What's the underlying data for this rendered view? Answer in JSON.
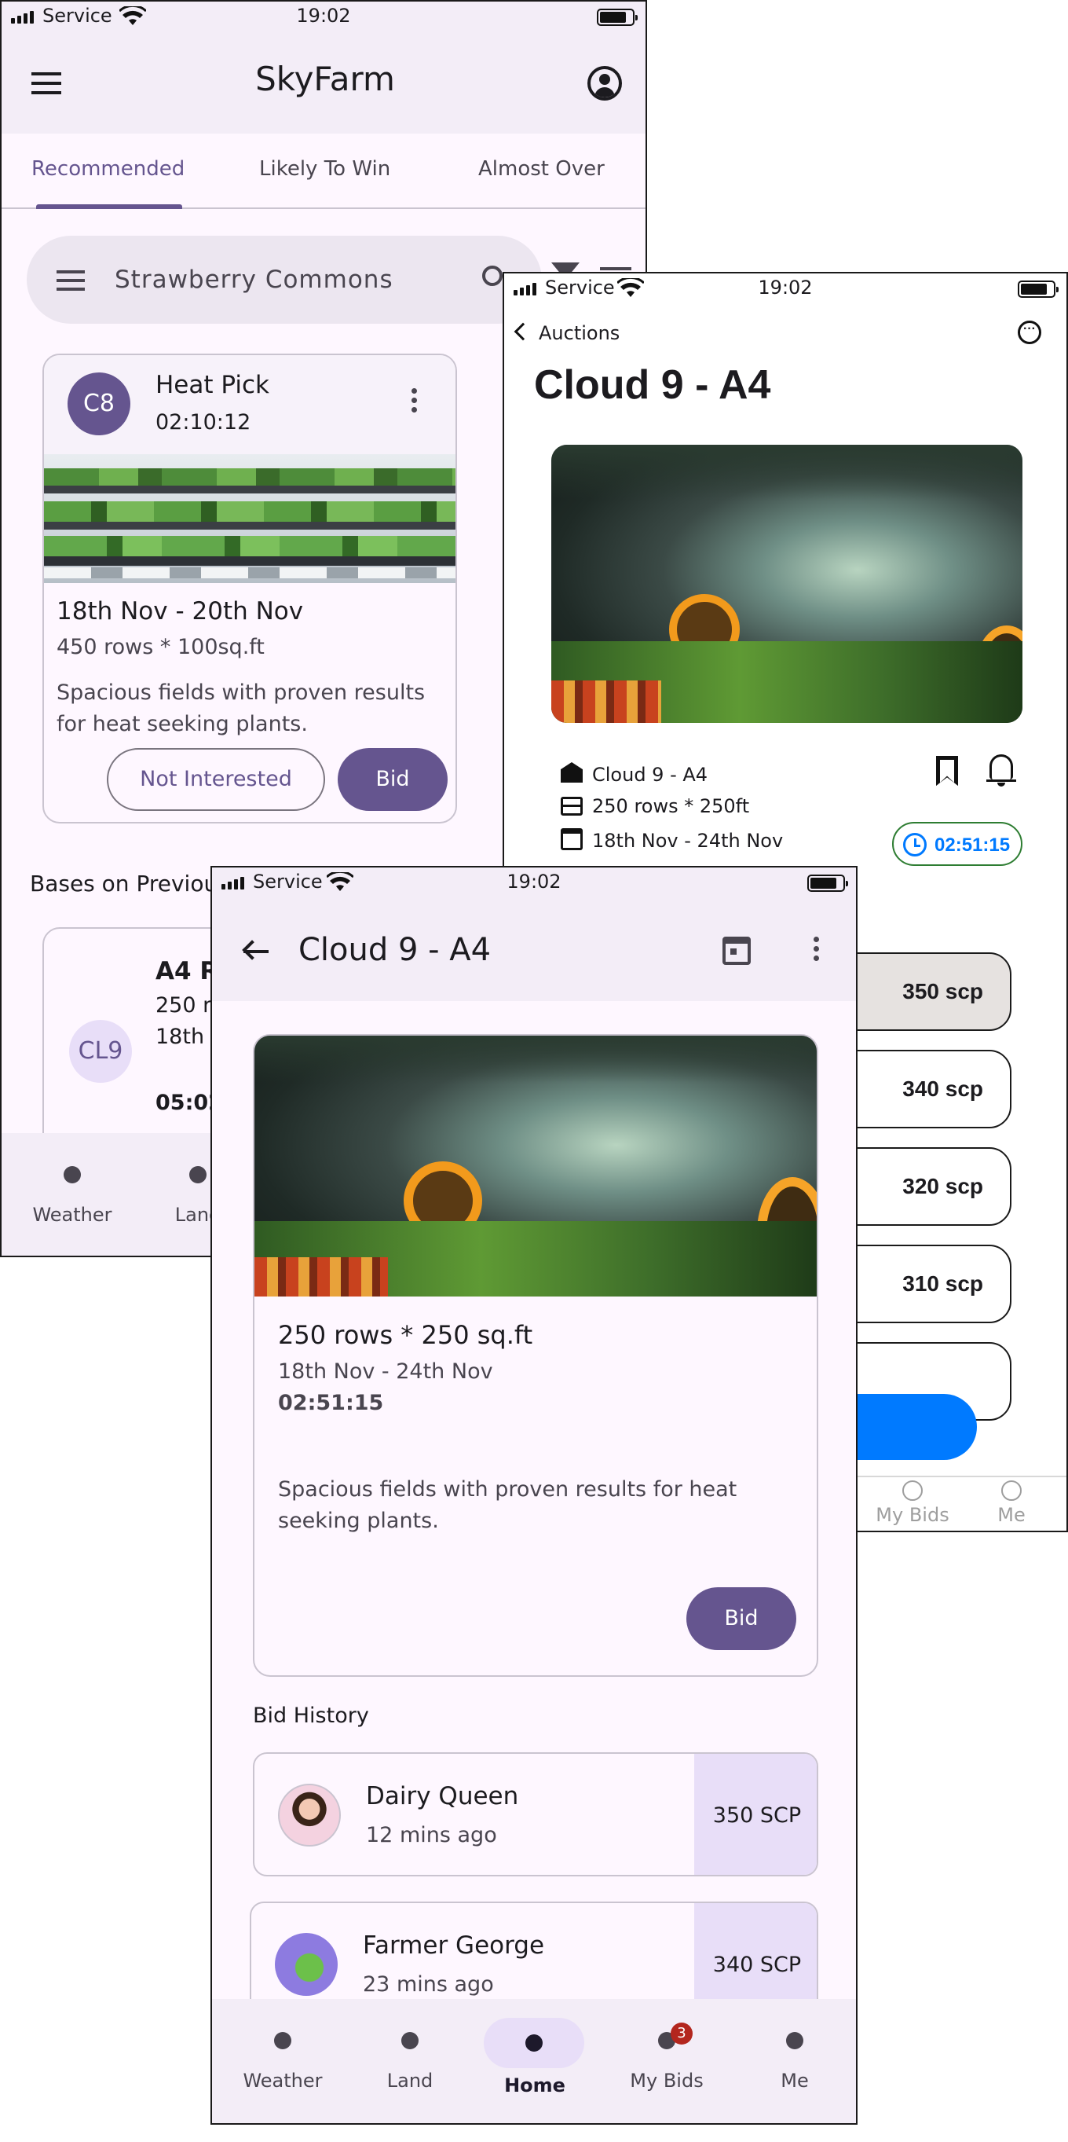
{
  "status": {
    "carrier": "Service",
    "time": "19:02"
  },
  "s1": {
    "app_title": "SkyFarm",
    "tabs": [
      "Recommended",
      "Likely To Win",
      "Almost Over"
    ],
    "search_placeholder": "Strawberry Commons",
    "card": {
      "avatar": "C8",
      "title": "Heat Pick",
      "timer": "02:10:12",
      "dates": "18th Nov - 20th Nov",
      "size": "450 rows * 100sq.ft",
      "desc": "Spacious fields with proven results for heat seeking plants.",
      "btn_secondary": "Not Interested",
      "btn_primary": "Bid"
    },
    "section_title": "Bases on Previous",
    "card2": {
      "avatar": "CL9",
      "title": "A4 Ra",
      "line1": "250 ro",
      "line2": "18th N",
      "timer": "05:02"
    },
    "nav": [
      "Weather",
      "Land"
    ]
  },
  "s2": {
    "back_label": "Auctions",
    "title": "Cloud 9 - A4",
    "info": [
      {
        "icon": "barn-icon",
        "text": "Cloud 9 - A4"
      },
      {
        "icon": "rows-icon",
        "text": "250 rows * 250ft"
      },
      {
        "icon": "calendar-icon",
        "text": "18th Nov - 24th Nov"
      }
    ],
    "timer": "02:51:15",
    "bids": [
      "350 scp",
      "340 scp",
      "320 scp",
      "310 scp"
    ],
    "nav": [
      "My Bids",
      "Me"
    ]
  },
  "s3": {
    "title": "Cloud 9 - A4",
    "size": "250 rows * 250 sq.ft",
    "dates": "18th Nov - 24th Nov",
    "timer": "02:51:15",
    "desc": "Spacious fields with proven results for heat seeking plants.",
    "bid_button": "Bid",
    "history_title": "Bid History",
    "history": [
      {
        "name": "Dairy Queen",
        "time": "12 mins ago",
        "amount": "350 SCP"
      },
      {
        "name": "Farmer George",
        "time": "23 mins ago",
        "amount": "340 SCP"
      }
    ],
    "nav": [
      "Weather",
      "Land",
      "Home",
      "My Bids",
      "Me"
    ],
    "badge": "3",
    "active_nav": "Home"
  },
  "colors": {
    "primary": "#65558f",
    "primary_container": "#e8def8",
    "surface": "#fef7ff",
    "accent_blue": "#007aff",
    "timer_green": "#2e7d32"
  }
}
